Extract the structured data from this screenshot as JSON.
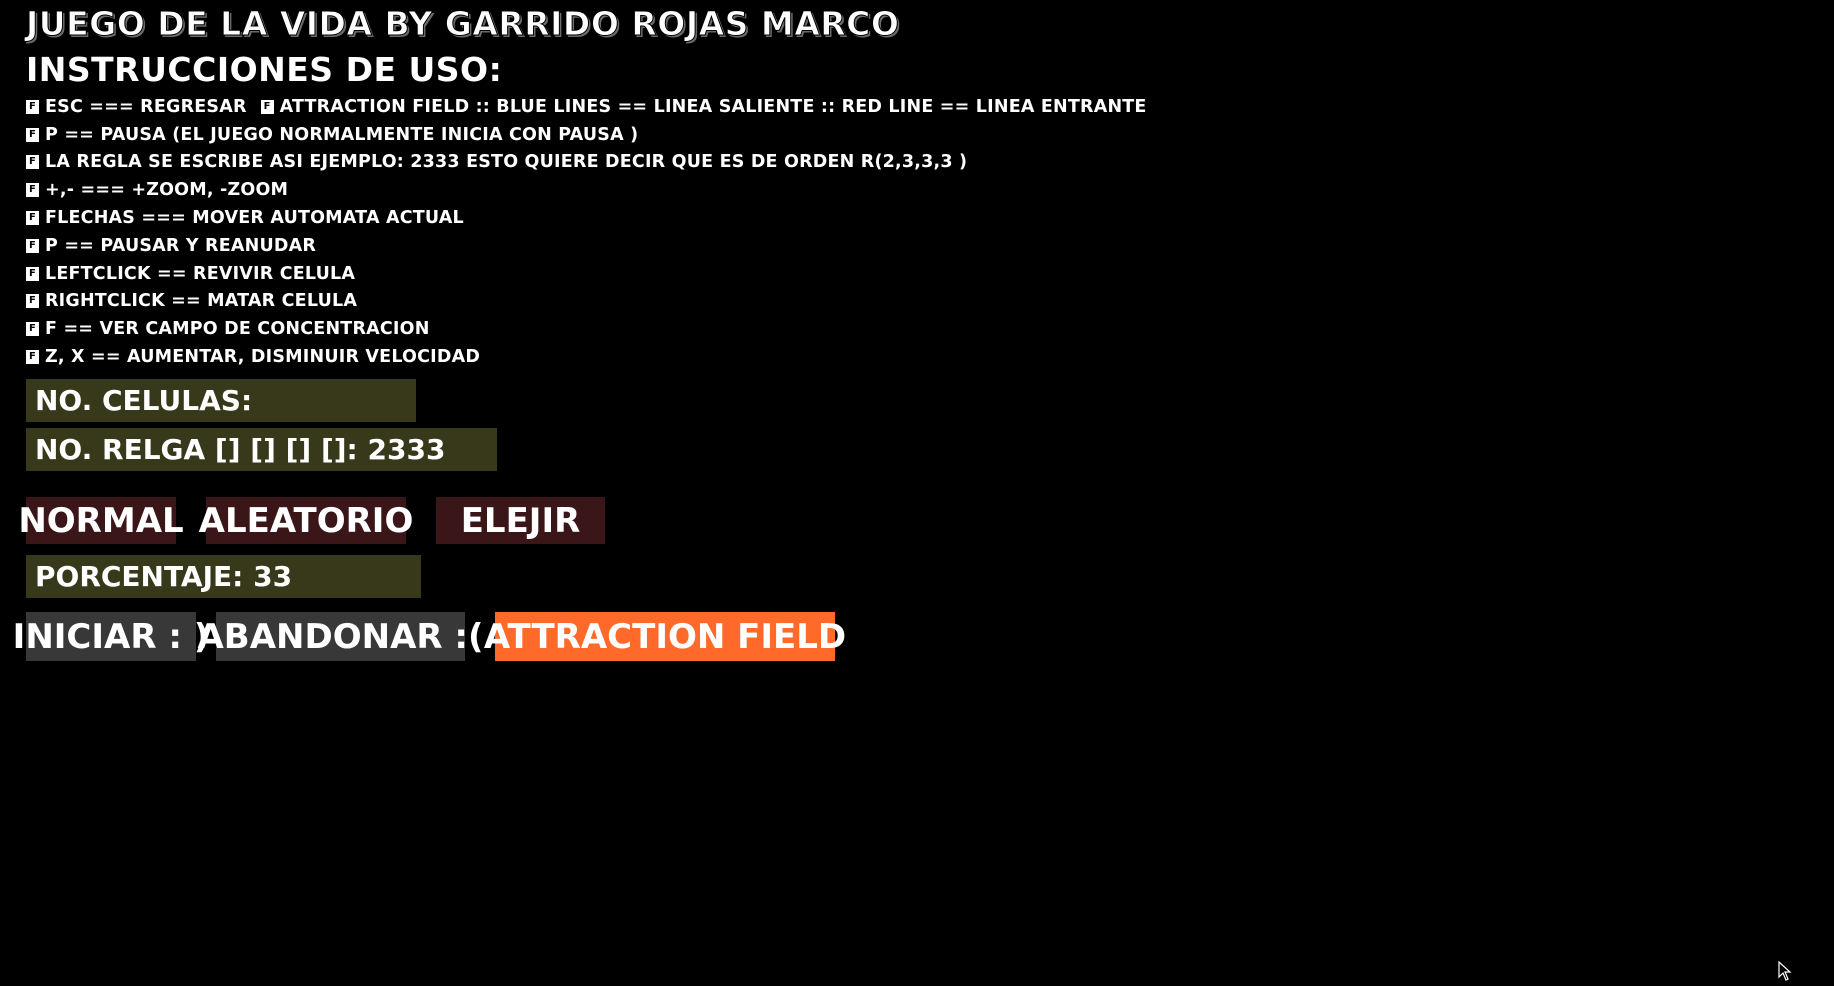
{
  "title": "JUEGO DE LA VIDA BY GARRIDO ROJAS MARCO",
  "instructions_heading": "INSTRUCCIONES DE USO:",
  "bullet_glyph": "F",
  "instructions": [
    "ESC === REGRESAR",
    "P == PAUSA (EL JUEGO NORMALMENTE INICIA CON PAUSA )",
    "LA REGLA SE ESCRIBE ASI EJEMPLO: 2333 ESTO QUIERE DECIR QUE ES DE ORDEN R(2,3,3,3 )",
    "+,- === +ZOOM, -ZOOM",
    "FLECHAS === MOVER AUTOMATA ACTUAL",
    "P == PAUSAR Y REANUDAR",
    "LEFTCLICK == REVIVIR CELULA",
    "RIGHTCLICK == MATAR CELULA",
    "F == VER CAMPO DE CONCENTRACION",
    "Z, X == AUMENTAR, DISMINUIR VELOCIDAD"
  ],
  "instruction_extra": "ATTRACTION FIELD :: BLUE LINES == LINEA SALIENTE :: RED LINE == LINEA ENTRANTE",
  "cells_label": "NO. CELULAS:",
  "rule_label": "NO. RELGA [] [] [] []: 2333",
  "modes": {
    "normal": "NORMAL",
    "random": "ALEATORIO",
    "choose": "ELEJIR"
  },
  "percentage_label": "PORCENTAJE: 33",
  "actions": {
    "start": "INICIAR : )",
    "quit": "ABANDONAR :(",
    "attraction": "ATTRACTION FIELD"
  },
  "colors": {
    "background": "#000000",
    "panel": "#38381a",
    "mode_button": "#3a1619",
    "action_button": "#383838",
    "attraction_button": "#ff6a2b"
  }
}
